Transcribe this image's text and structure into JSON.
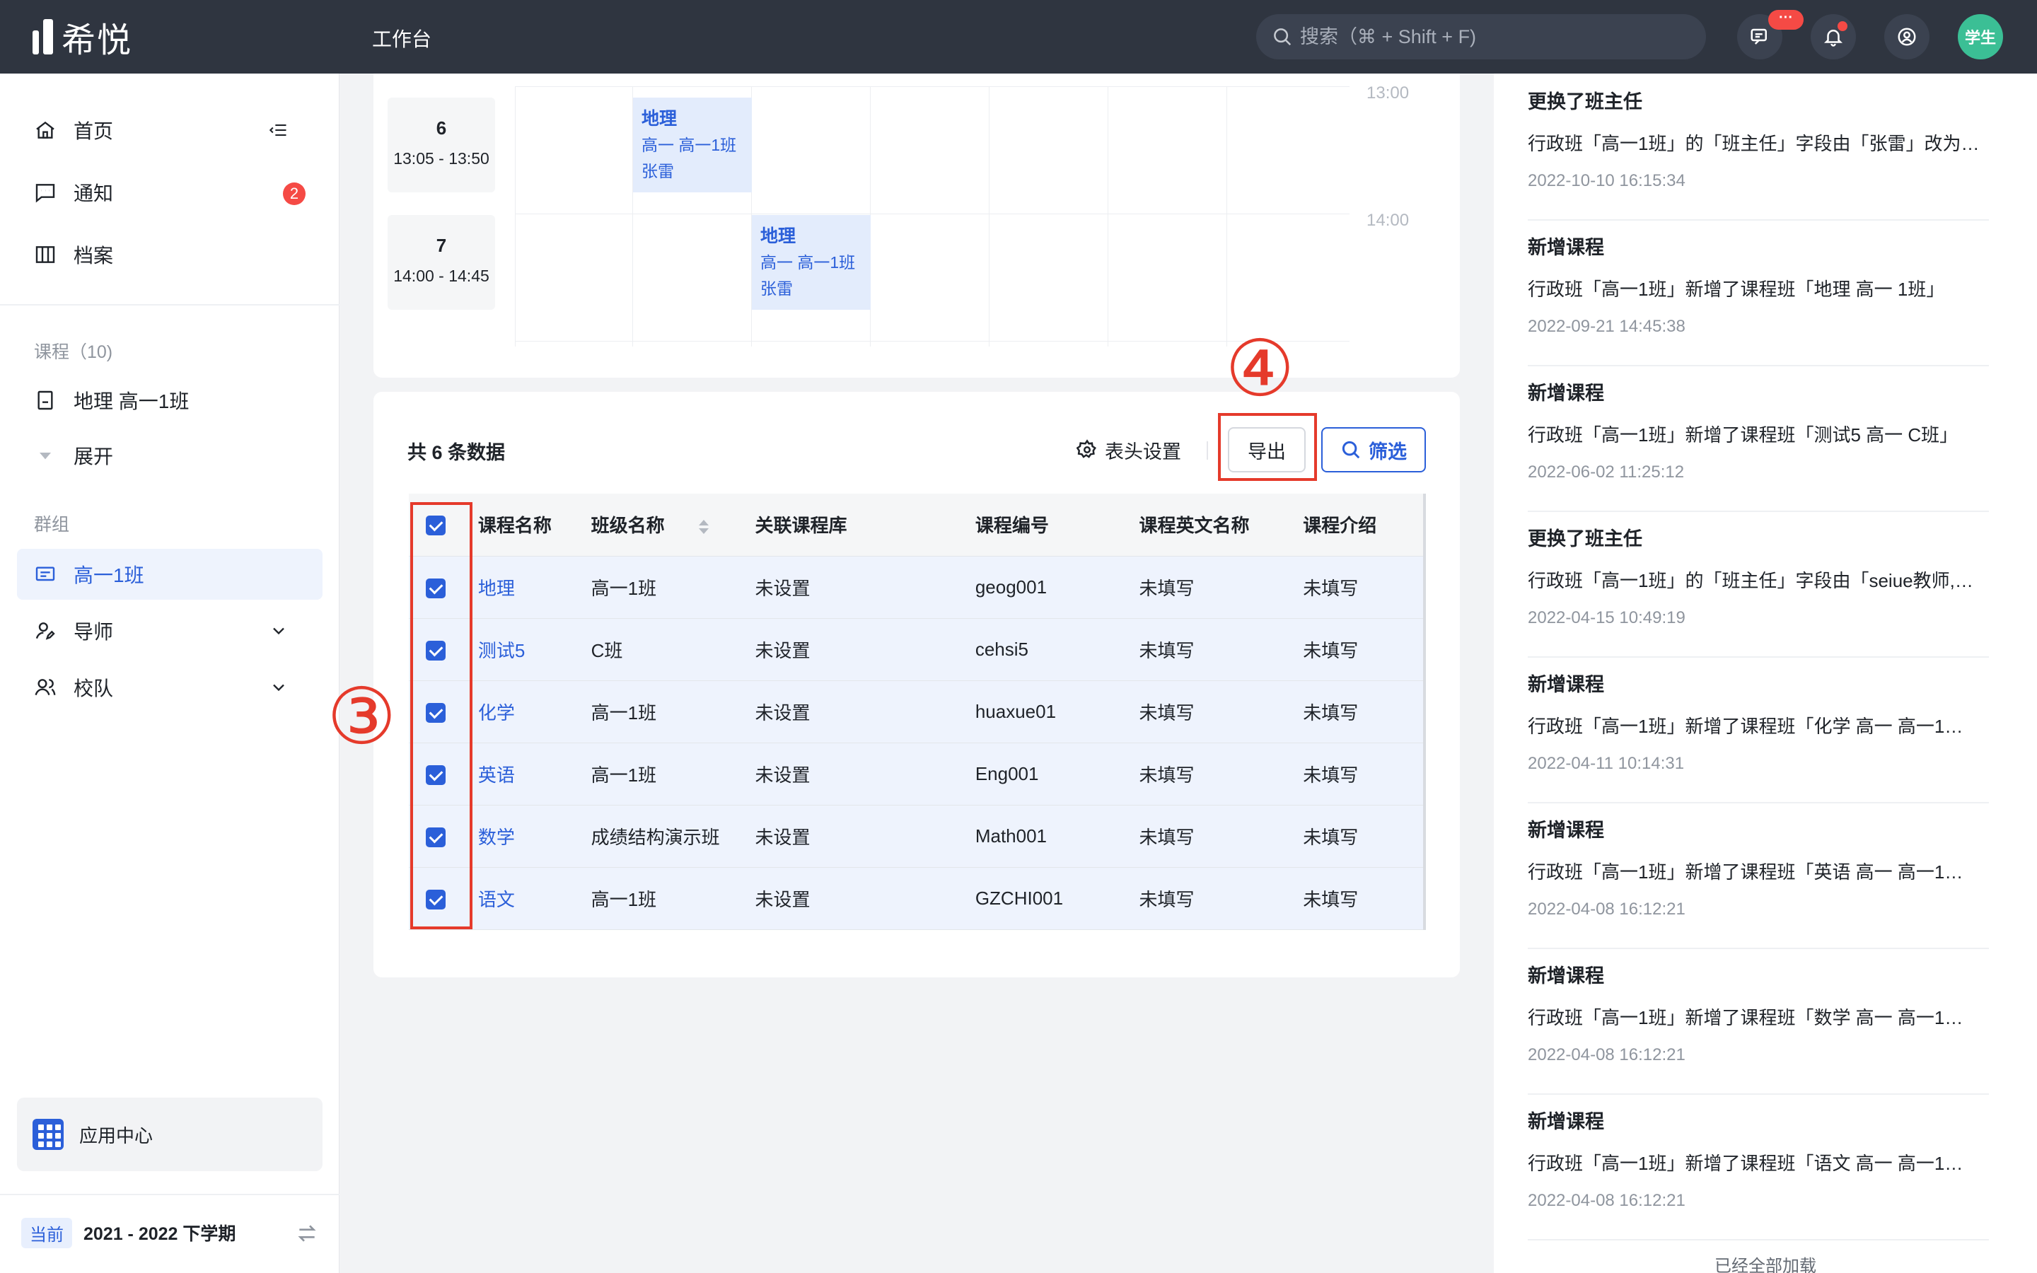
{
  "topbar": {
    "logo_text": "希悦",
    "title": "工作台",
    "search_placeholder": "搜索（⌘ + Shift + F)",
    "message_badge": "···",
    "avatar_text": "学生"
  },
  "sidebar": {
    "nav": [
      {
        "label": "首页"
      },
      {
        "label": "通知",
        "badge": "2"
      },
      {
        "label": "档案"
      }
    ],
    "course_section_label": "课程（10)",
    "course_item": "地理 高一1班",
    "expand_label": "展开",
    "group_section_label": "群组",
    "group_items": [
      {
        "label": "高一1班"
      },
      {
        "label": "导师"
      },
      {
        "label": "校队"
      }
    ],
    "app_center": "应用中心",
    "semester_tag": "当前",
    "semester": "2021 - 2022 下学期"
  },
  "schedule": {
    "periods": [
      {
        "num": "6",
        "time": "13:05 - 13:50"
      },
      {
        "num": "7",
        "time": "14:00 - 14:45"
      }
    ],
    "time_labels": [
      "13:00",
      "14:00"
    ],
    "lessons": [
      {
        "subject": "地理",
        "class": "高一  高一1班",
        "teacher": "张雷"
      },
      {
        "subject": "地理",
        "class": "高一  高一1班",
        "teacher": "张雷"
      }
    ]
  },
  "table": {
    "total": "共 6 条数据",
    "header_settings": "表头设置",
    "export_label": "导出",
    "filter_label": "筛选",
    "columns": [
      "课程名称",
      "班级名称",
      "关联课程库",
      "课程编号",
      "课程英文名称",
      "课程介绍"
    ],
    "rows": [
      {
        "name": "地理",
        "class": "高一1班",
        "lib": "未设置",
        "code": "geog001",
        "en": "未填写",
        "intro": "未填写"
      },
      {
        "name": "测试5",
        "class": "C班",
        "lib": "未设置",
        "code": "cehsi5",
        "en": "未填写",
        "intro": "未填写"
      },
      {
        "name": "化学",
        "class": "高一1班",
        "lib": "未设置",
        "code": "huaxue01",
        "en": "未填写",
        "intro": "未填写"
      },
      {
        "name": "英语",
        "class": "高一1班",
        "lib": "未设置",
        "code": "Eng001",
        "en": "未填写",
        "intro": "未填写"
      },
      {
        "name": "数学",
        "class": "成绩结构演示班",
        "lib": "未设置",
        "code": "Math001",
        "en": "未填写",
        "intro": "未填写"
      },
      {
        "name": "语文",
        "class": "高一1班",
        "lib": "未设置",
        "code": "GZCHI001",
        "en": "未填写",
        "intro": "未填写"
      }
    ]
  },
  "annotations": {
    "step3": "③",
    "step4": "④"
  },
  "activity": {
    "items": [
      {
        "title": "更换了班主任",
        "desc": "行政班「高一1班」的「班主任」字段由「张雷」改为…",
        "time": "2022-10-10 16:15:34"
      },
      {
        "title": "新增课程",
        "desc": "行政班「高一1班」新增了课程班「地理 高一 1班」",
        "time": "2022-09-21 14:45:38"
      },
      {
        "title": "新增课程",
        "desc": "行政班「高一1班」新增了课程班「测试5 高一 C班」",
        "time": "2022-06-02 11:25:12"
      },
      {
        "title": "更换了班主任",
        "desc": "行政班「高一1班」的「班主任」字段由「seiue教师,…",
        "time": "2022-04-15 10:49:19"
      },
      {
        "title": "新增课程",
        "desc": "行政班「高一1班」新增了课程班「化学 高一 高一1…",
        "time": "2022-04-11 10:14:31"
      },
      {
        "title": "新增课程",
        "desc": "行政班「高一1班」新增了课程班「英语 高一 高一1…",
        "time": "2022-04-08 16:12:21"
      },
      {
        "title": "新增课程",
        "desc": "行政班「高一1班」新增了课程班「数学 高一 高一1…",
        "time": "2022-04-08 16:12:21"
      },
      {
        "title": "新增课程",
        "desc": "行政班「高一1班」新增了课程班「语文 高一 高一1…",
        "time": "2022-04-08 16:12:21"
      }
    ],
    "loaded_text": "已经全部加载"
  },
  "colors": {
    "accent": "#2b5fd9",
    "topbar": "#2f3540",
    "annotation": "#e53a2b",
    "badge": "#f54a45"
  }
}
